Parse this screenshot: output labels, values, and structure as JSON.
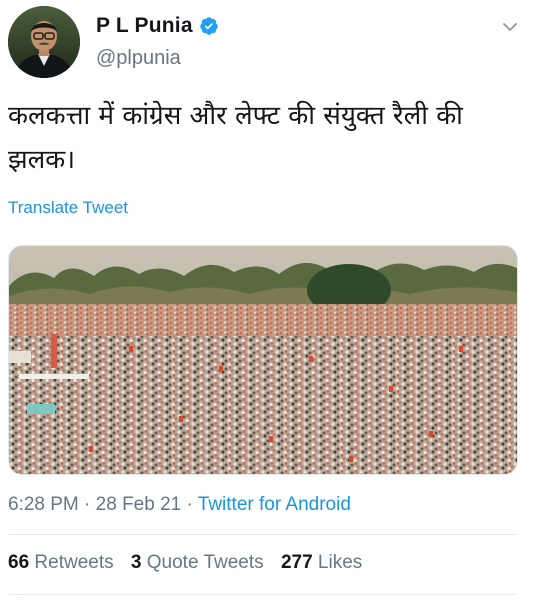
{
  "user": {
    "display_name": "P L Punia",
    "handle": "@plpunia",
    "verified": true
  },
  "tweet": {
    "text": "कलकत्ता में कांग्रेस और लेफ्ट की संयुक्त रैली की झलक।",
    "translate_label": "Translate Tweet"
  },
  "meta": {
    "time": "6:28 PM",
    "separator": "·",
    "date": "28 Feb 21",
    "source": "Twitter for Android"
  },
  "stats": {
    "retweets_count": "66",
    "retweets_label": "Retweets",
    "quote_count": "3",
    "quote_label": "Quote Tweets",
    "likes_count": "277",
    "likes_label": "Likes"
  },
  "colors": {
    "link": "#1b95e0",
    "secondary_text": "#657786",
    "verified_badge": "#1da1f2"
  },
  "icons": {
    "verified": "verified-badge-icon",
    "menu": "chevron-down-icon"
  }
}
